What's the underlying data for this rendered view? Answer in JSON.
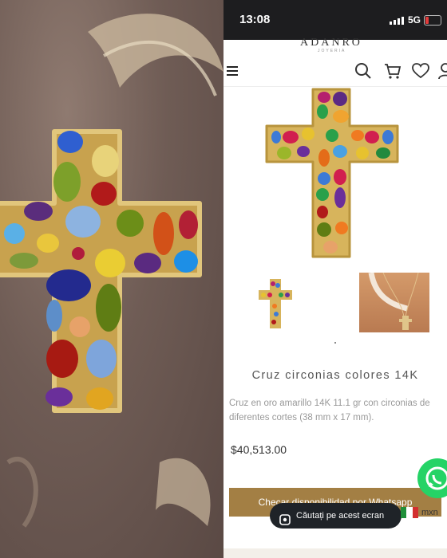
{
  "status_bar": {
    "time": "13:08",
    "network": "5G"
  },
  "brand": {
    "name": "ADANRO",
    "tagline": "JOYERIA"
  },
  "header": {
    "icons": [
      "menu-icon",
      "search-icon",
      "cart-icon",
      "heart-icon",
      "user-icon"
    ]
  },
  "product": {
    "title": "Cruz circonias colores 14K",
    "description": "Cruz en oro amarillo 14K 11.1 gr con circonias de diferentes cortes (38 mm x 17 mm).",
    "price": "$40,513.00"
  },
  "cta": {
    "label": "Checar disponibilidad por Whatsapp"
  },
  "lens": {
    "label": "Căutați pe acest ecran"
  },
  "currency": {
    "code": "mxn"
  },
  "colors": {
    "accent": "#a37f44",
    "whatsapp": "#25d366",
    "status_bar": "#1d1d1f"
  }
}
